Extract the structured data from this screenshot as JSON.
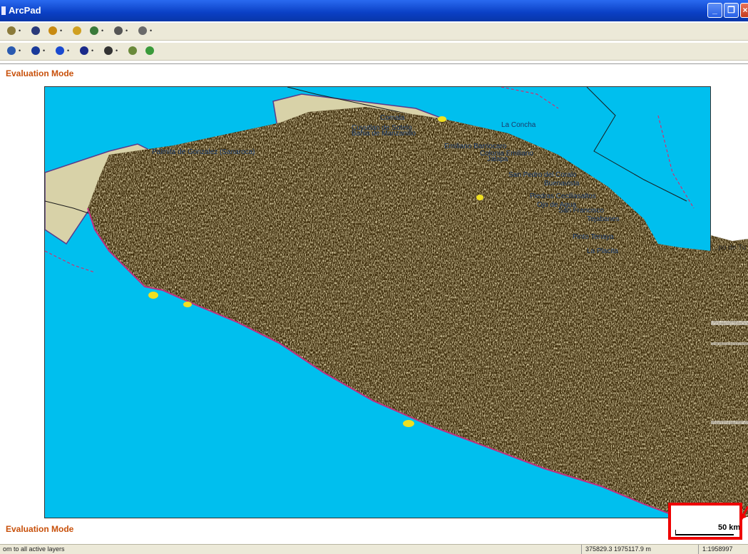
{
  "window": {
    "title": "ArcPad"
  },
  "toolbar1": {
    "tools": [
      {
        "icon": "open-folder-icon",
        "dropdown": true,
        "color": "#8a7a3a"
      },
      {
        "icon": "save-icon",
        "dropdown": false,
        "color": "#2a3a7a"
      },
      {
        "icon": "gps-position-icon",
        "dropdown": true,
        "color": "#c88a10"
      },
      {
        "icon": "layers-icon",
        "dropdown": false,
        "color": "#d0a020"
      },
      {
        "icon": "pen-edit-icon",
        "dropdown": true,
        "color": "#3a7a3a"
      },
      {
        "icon": "tools-icon",
        "dropdown": true,
        "color": "#555555"
      },
      {
        "icon": "help-icon",
        "dropdown": true,
        "color": "#6a6a6a"
      }
    ]
  },
  "toolbar2": {
    "tools": [
      {
        "icon": "zoom-in-icon",
        "dropdown": true,
        "color": "#2a5ab0"
      },
      {
        "icon": "globe-icon",
        "dropdown": true,
        "color": "#1a3a9a"
      },
      {
        "icon": "back-arrow-icon",
        "dropdown": true,
        "color": "#1a4ad0"
      },
      {
        "icon": "identify-icon",
        "dropdown": true,
        "color": "#1a2a8a"
      },
      {
        "icon": "find-binoculars-icon",
        "dropdown": true,
        "color": "#333333"
      },
      {
        "icon": "hyperlink-icon",
        "dropdown": false,
        "color": "#6a8a3a"
      },
      {
        "icon": "go-to-icon",
        "dropdown": false,
        "color": "#3a9a3a"
      }
    ]
  },
  "evaluation_mode_top": "Evaluation Mode",
  "evaluation_mode_bottom": "Evaluation Mode",
  "map": {
    "water_color": "#00bfee",
    "land_color": "#d8d2a8",
    "label_mass_color": "#3b2a08",
    "boundary_color": "#d03070",
    "labels": [
      "Comala",
      "Cuyutlan de Sotelo",
      "Bahia de Manzanillo",
      "La Concha",
      "Palmita de Gonzalez (Sanaroca)",
      "Emiliano Barriocaro",
      "Colonia Emiliano",
      "San Pedro del Coralo",
      "Jalapa",
      "Buenavista",
      "Piedras Ceciliasaltos",
      "Ojo de Agua",
      "San Francisco",
      "Tejabanes",
      "Pinto Tenaya",
      "La Placita"
    ],
    "overflow_label": "...po de Tu J"
  },
  "scale": {
    "label": "50 km"
  },
  "status": {
    "message": "om to all active layers",
    "coordinates": "375829.3 1975117.9 m",
    "scale_ratio": "1:1958997"
  }
}
